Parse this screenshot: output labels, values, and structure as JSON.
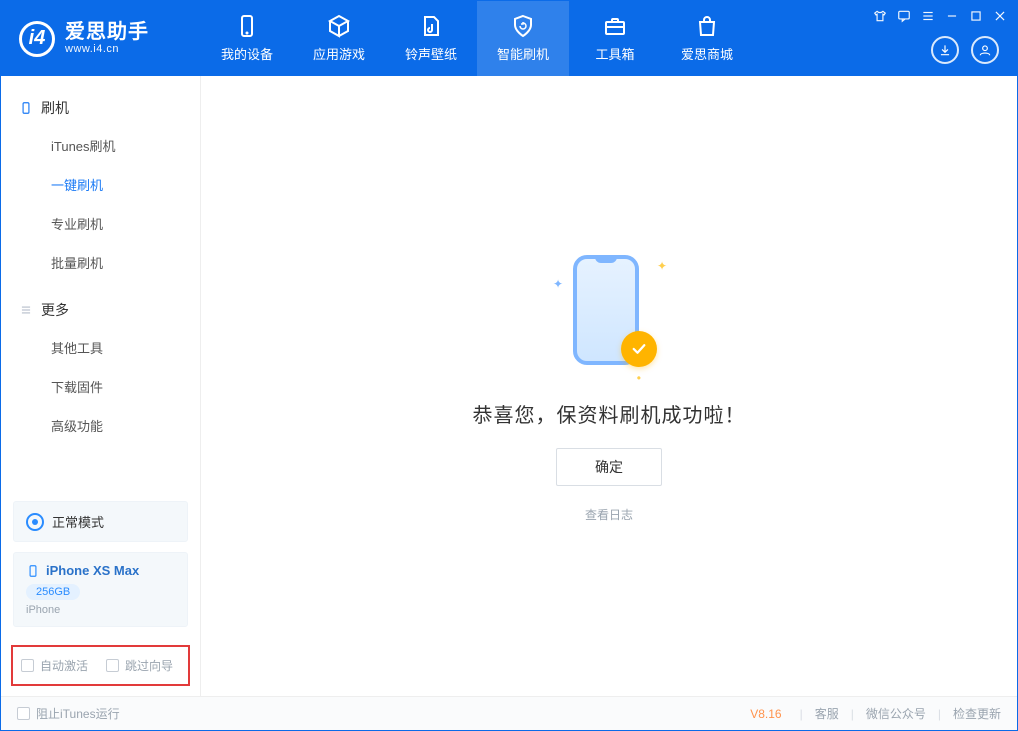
{
  "app": {
    "title": "爱思助手",
    "subtitle": "www.i4.cn"
  },
  "nav": {
    "items": [
      {
        "label": "我的设备"
      },
      {
        "label": "应用游戏"
      },
      {
        "label": "铃声壁纸"
      },
      {
        "label": "智能刷机"
      },
      {
        "label": "工具箱"
      },
      {
        "label": "爱思商城"
      }
    ],
    "active_index": 3
  },
  "sidebar": {
    "section1": {
      "title": "刷机",
      "items": [
        "iTunes刷机",
        "一键刷机",
        "专业刷机",
        "批量刷机"
      ],
      "active_index": 1
    },
    "section2": {
      "title": "更多",
      "items": [
        "其他工具",
        "下载固件",
        "高级功能"
      ]
    }
  },
  "mode": {
    "label": "正常模式"
  },
  "device": {
    "name": "iPhone XS Max",
    "capacity": "256GB",
    "type": "iPhone"
  },
  "options": {
    "auto_activate": "自动激活",
    "skip_guide": "跳过向导"
  },
  "main": {
    "success_text": "恭喜您，保资料刷机成功啦！",
    "ok_button": "确定",
    "view_log": "查看日志"
  },
  "footer": {
    "block_itunes": "阻止iTunes运行",
    "version": "V8.16",
    "links": [
      "客服",
      "微信公众号",
      "检查更新"
    ]
  }
}
